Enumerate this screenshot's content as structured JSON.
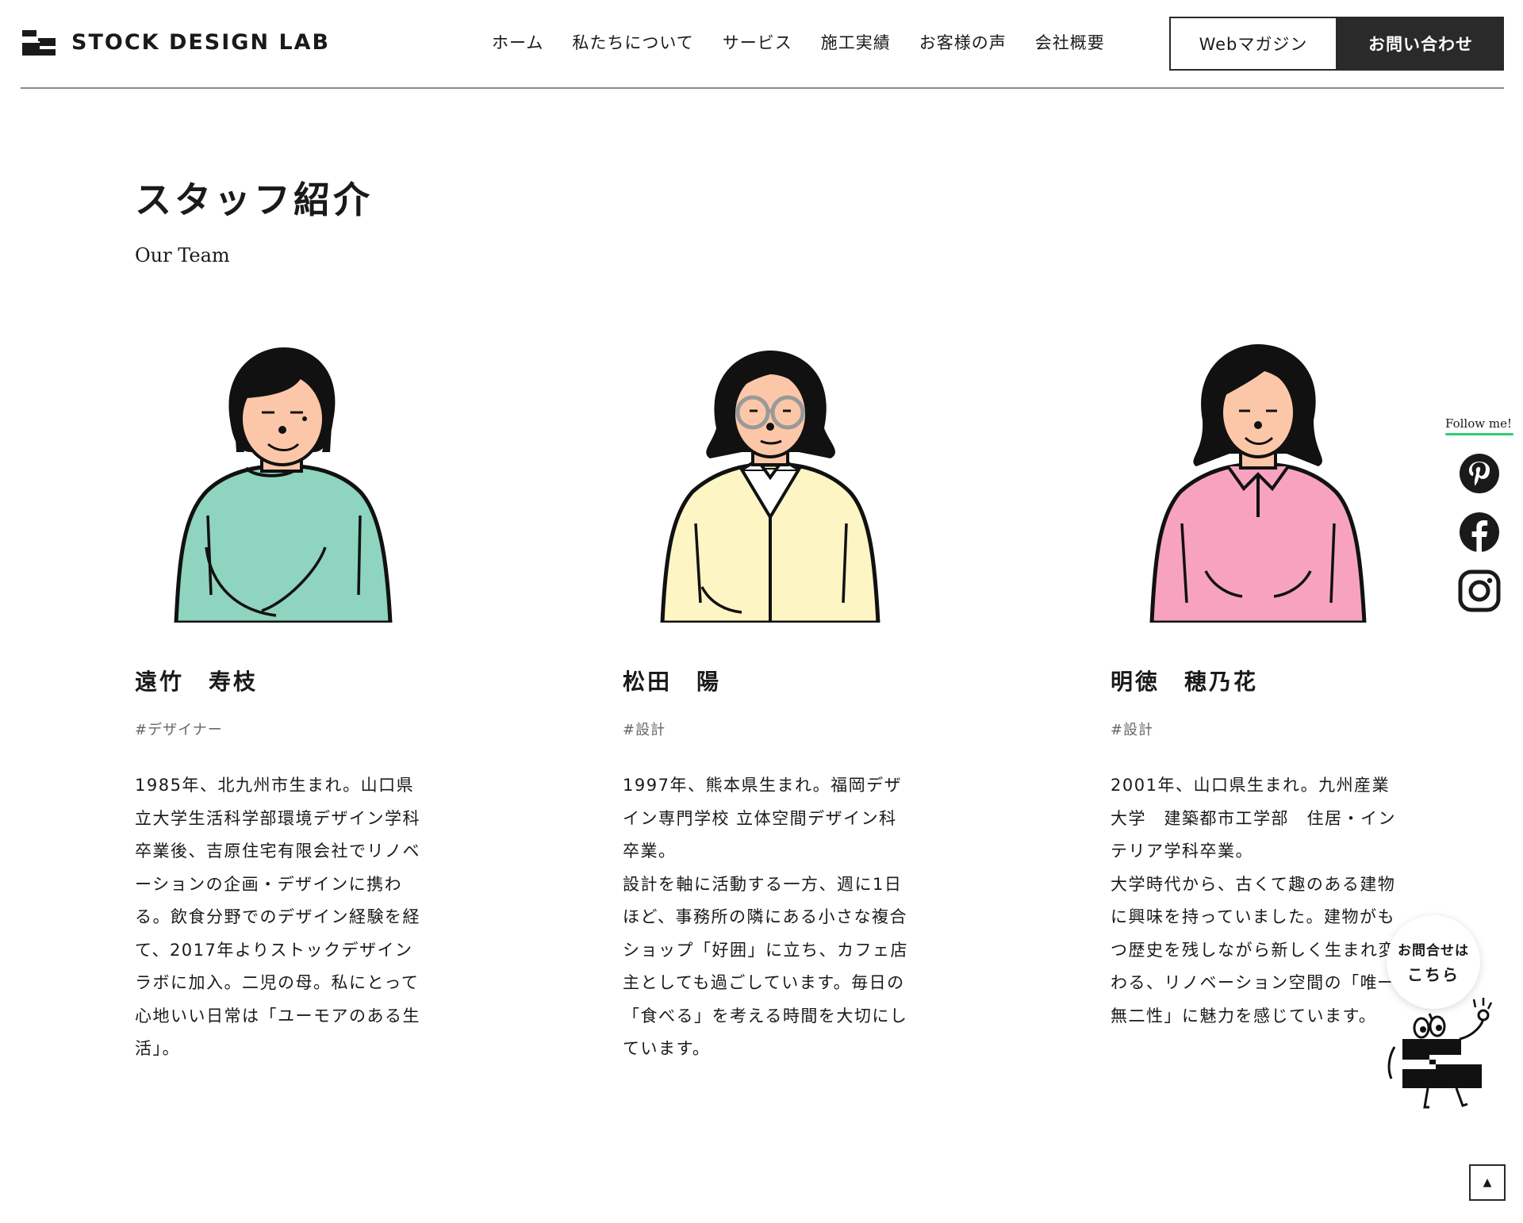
{
  "header": {
    "logo_text": "STOCK DESIGN LAB",
    "nav": [
      {
        "label": "ホーム"
      },
      {
        "label": "私たちについて"
      },
      {
        "label": "サービス"
      },
      {
        "label": "施工実績"
      },
      {
        "label": "お客様の声"
      },
      {
        "label": "会社概要"
      }
    ],
    "magazine_button": "Webマガジン",
    "contact_button": "お問い合わせ"
  },
  "section": {
    "title": "スタッフ紹介",
    "subtitle": "Our Team"
  },
  "staff": [
    {
      "name": "遠竹　寿枝",
      "tag": "#デザイナー",
      "bio": "1985年、北九州市生まれ。山口県立大学生活科学部環境デザイン学科卒業後、吉原住宅有限会社でリノベーションの企画・デザインに携わる。飲食分野でのデザイン経験を経て、2017年よりストックデザインラボに加入。二児の母。私にとって心地いい日常は「ユーモアのある生活」。",
      "sweater_color": "#8ed4bf"
    },
    {
      "name": "松田　陽",
      "tag": "#設計",
      "bio": "1997年、熊本県生まれ。福岡デザイン専門学校 立体空間デザイン科卒業。\n設計を軸に活動する一方、週に1日ほど、事務所の隣にある小さな複合ショップ「好囲」に立ち、カフェ店主としても過ごしています。毎日の「食べる」を考える時間を大切にしています。",
      "sweater_color": "#fdf5c4"
    },
    {
      "name": "明徳　穂乃花",
      "tag": "#設計",
      "bio": "2001年、山口県生まれ。九州産業大学　建築都市工学部　住居・インテリア学科卒業。\n大学時代から、古くて趣のある建物に興味を持っていました。建物がもつ歴史を残しながら新しく生まれ変わる、リノベーション空間の「唯一無二性」に魅力を感じています。",
      "sweater_color": "#f7a3bf"
    }
  ],
  "social": {
    "follow_label": "Follow me!",
    "icons": [
      "pinterest-icon",
      "facebook-icon",
      "instagram-icon"
    ]
  },
  "floating_contact": {
    "line1": "お問合せは",
    "line2": "こちら"
  },
  "colors": {
    "text": "#1a1a1a",
    "dark_button": "#2a2a2a",
    "follow_underline": "#2ecc71",
    "skin": "#fcc7a8"
  }
}
